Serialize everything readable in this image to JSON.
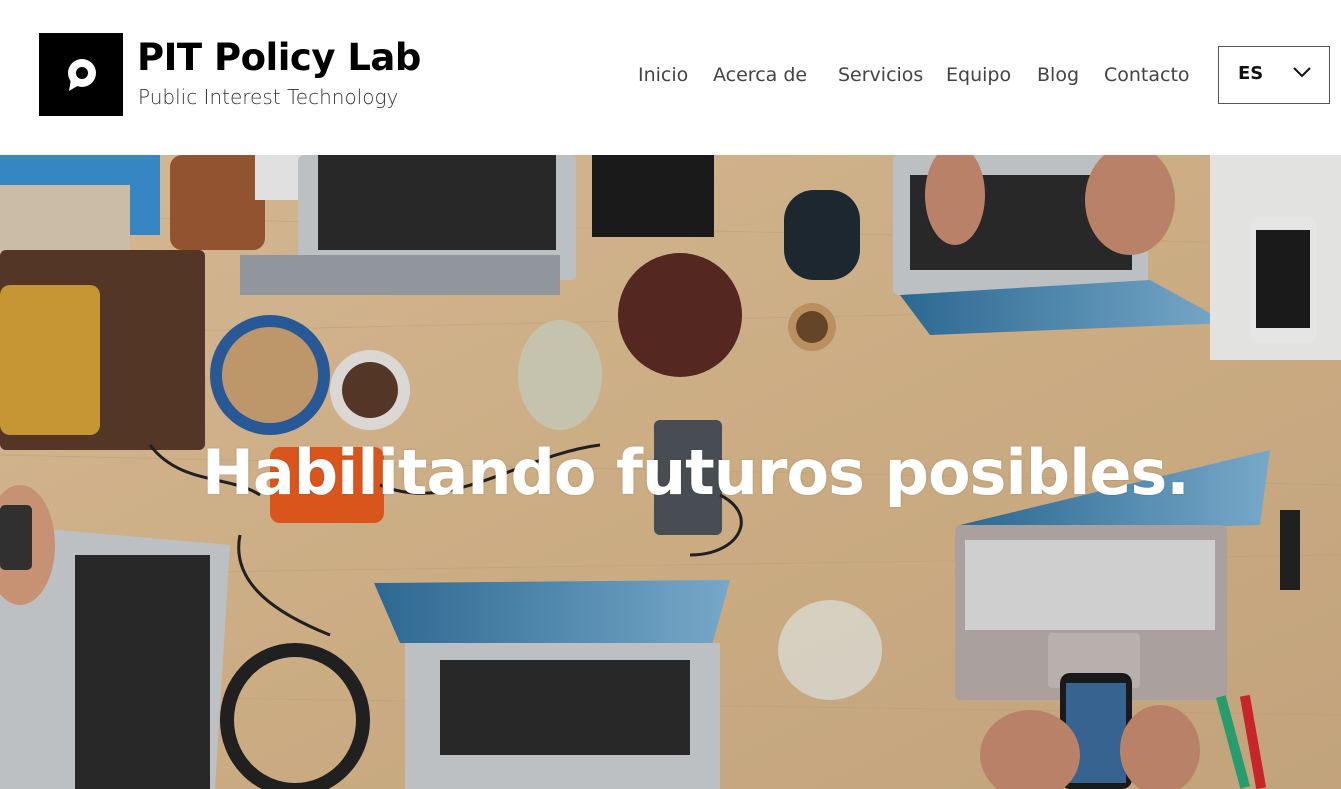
{
  "brand": {
    "title": "PIT Policy Lab",
    "subtitle": "Public Interest Technology",
    "logo_icon": "p-speech-bubble-icon"
  },
  "nav": {
    "items": [
      {
        "label": "Inicio"
      },
      {
        "label": "Acerca de"
      },
      {
        "label": "Servicios"
      },
      {
        "label": "Equipo"
      },
      {
        "label": "Blog"
      },
      {
        "label": "Contacto"
      }
    ]
  },
  "language": {
    "selected": "ES",
    "icon": "chevron-down-icon"
  },
  "hero": {
    "headline": "Habilitando futuros posibles.",
    "image_subject": "desk-with-laptops-photo"
  },
  "colors": {
    "header_bg": "#ffffff",
    "logo_bg": "#000000",
    "hero_text": "#ffffff",
    "table_wood": "#d9b98f"
  }
}
